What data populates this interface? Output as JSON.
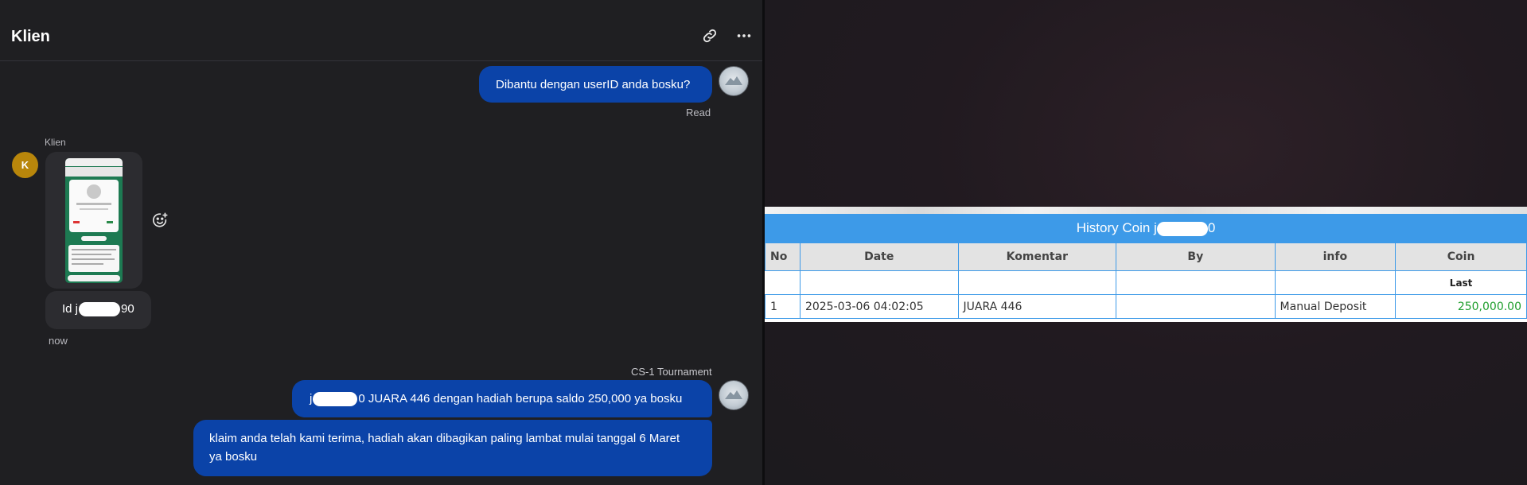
{
  "chat": {
    "title": "Klien",
    "messages": {
      "m1": {
        "text": "Dibantu dengan userID anda bosku?",
        "status": "Read"
      },
      "client_name": "Klien",
      "client_avatar_letter": "K",
      "m2_prefix": "Id j",
      "m2_suffix": "90",
      "m2_time": "now",
      "agent_name": "CS-1 Tournament",
      "m3_prefix": "j",
      "m3_suffix": "0 JUARA 446 dengan hadiah berupa saldo 250,000 ya bosku",
      "m4": "klaim anda telah kami terima, hadiah akan dibagikan paling lambat mulai tanggal 6 Maret ya bosku"
    }
  },
  "history": {
    "title_prefix": "History Coin j",
    "title_suffix": "0",
    "columns": [
      "No",
      "Date",
      "Komentar",
      "By",
      "info",
      "Coin"
    ],
    "sub_header": "Last",
    "rows": [
      {
        "no": "1",
        "date": "2025-03-06 04:02:05",
        "komentar": "JUARA 446",
        "by": "",
        "info": "Manual Deposit",
        "coin": "250,000.00"
      }
    ]
  },
  "colors": {
    "accent_blue": "#0b43a8",
    "table_header": "#3d9ae8",
    "amount_green": "#1e9e2c",
    "client_avatar": "#b8860b"
  }
}
